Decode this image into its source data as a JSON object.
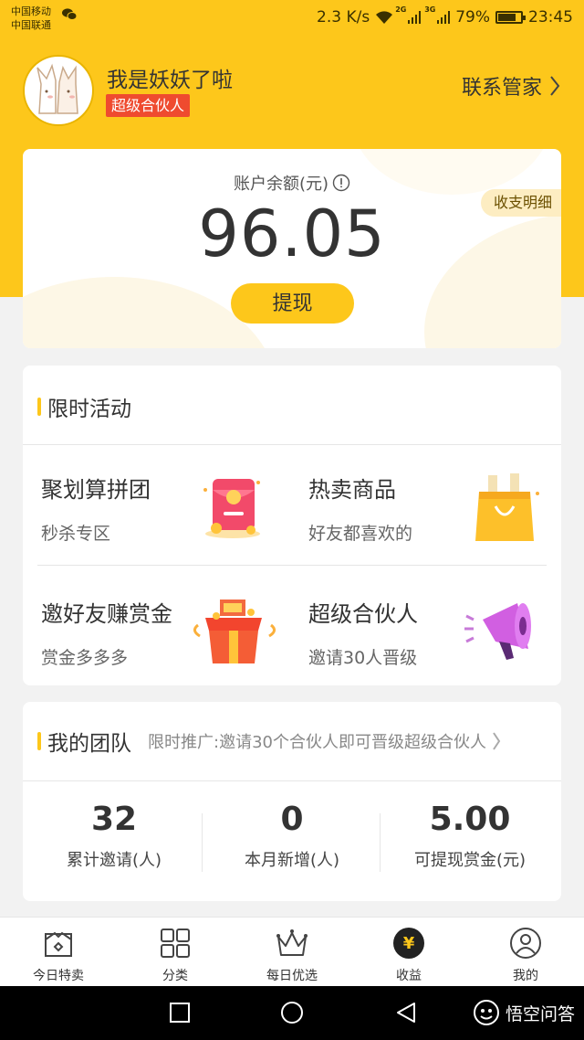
{
  "status_bar": {
    "carrier1": "中国移动",
    "carrier2": "中国联通",
    "net_speed": "2.3 K/s",
    "sig1_tag": "2G",
    "sig2_tag": "3G",
    "battery": "79%",
    "battery_level": 0.79,
    "time": "23:45"
  },
  "profile": {
    "username": "我是妖妖了啦",
    "badge": "超级合伙人",
    "contact_label": "联系管家"
  },
  "balance": {
    "label": "账户余额(元)",
    "amount": "96.05",
    "ledger_label": "收支明细",
    "withdraw_label": "提现"
  },
  "activities": {
    "title": "限时活动",
    "items": [
      {
        "title": "聚划算拼团",
        "subtitle": "秒杀专区",
        "icon": "red-envelope-icon"
      },
      {
        "title": "热卖商品",
        "subtitle": "好友都喜欢的",
        "icon": "shopping-bag-icon"
      },
      {
        "title": "邀好友赚赏金",
        "subtitle": "赏金多多多",
        "icon": "gift-box-icon"
      },
      {
        "title": "超级合伙人",
        "subtitle": "邀请30人晋级",
        "icon": "megaphone-icon"
      }
    ]
  },
  "team": {
    "title": "我的团队",
    "promo": "限时推广:邀请30个合伙人即可晋级超级合伙人",
    "stats": [
      {
        "value": "32",
        "label": "累计邀请(人)"
      },
      {
        "value": "0",
        "label": "本月新增(人)"
      },
      {
        "value": "5.00",
        "label": "可提现赏金(元)"
      }
    ]
  },
  "tabs": [
    {
      "label": "今日特卖",
      "icon": "today-sale-icon"
    },
    {
      "label": "分类",
      "icon": "category-grid-icon"
    },
    {
      "label": "每日优选",
      "icon": "crown-icon"
    },
    {
      "label": "收益",
      "icon": "yen-coin-icon",
      "active": true,
      "glyph": "¥"
    },
    {
      "label": "我的",
      "icon": "user-profile-icon"
    }
  ],
  "watermark": "悟空问答",
  "colors": {
    "brand_yellow": "#fdc71b",
    "badge_red": "#ef4b2f",
    "text_dark": "#333333"
  }
}
